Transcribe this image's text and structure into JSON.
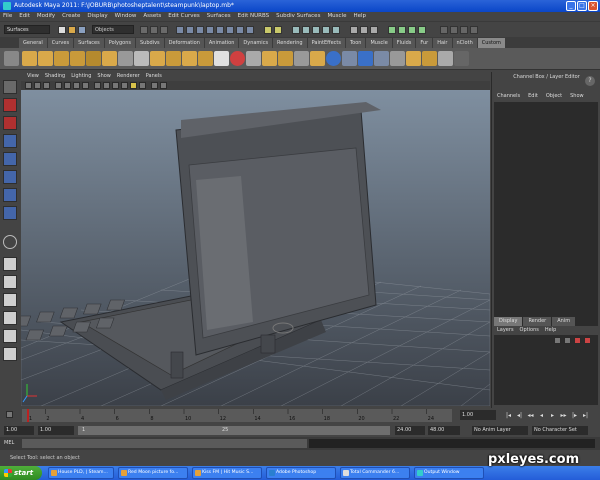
{
  "window": {
    "title": "Autodesk Maya 2011: F:\\JOBURB\\photosheptalent\\steampunk\\laptop.mb*"
  },
  "menubar": {
    "items": [
      "File",
      "Edit",
      "Modify",
      "Create",
      "Display",
      "Window",
      "Assets",
      "Edit Curves",
      "Surfaces",
      "Edit NURBS",
      "Subdiv Surfaces",
      "Muscle",
      "Help"
    ]
  },
  "statusline": {
    "mode": "Surfaces",
    "object_field": "Objects"
  },
  "shelf": {
    "tabs": [
      "General",
      "Curves",
      "Surfaces",
      "Polygons",
      "Subdivs",
      "Deformation",
      "Animation",
      "Dynamics",
      "Rendering",
      "PaintEffects",
      "Toon",
      "Muscle",
      "Fluids",
      "Fur",
      "Hair",
      "nCloth",
      "Custom"
    ],
    "active_tab": "Custom"
  },
  "viewport": {
    "menu": [
      "View",
      "Shading",
      "Lighting",
      "Show",
      "Renderer",
      "Panels"
    ]
  },
  "channel_box": {
    "title": "Channel Box / Layer Editor",
    "menu": [
      "Channels",
      "Edit",
      "Object",
      "Show"
    ],
    "layer_tabs": [
      "Display",
      "Render",
      "Anim"
    ],
    "active_layer_tab": "Display",
    "layer_menu": [
      "Layers",
      "Options",
      "Help"
    ]
  },
  "timeslider": {
    "ticks": [
      "1",
      "2",
      "4",
      "6",
      "8",
      "10",
      "12",
      "14",
      "16",
      "18",
      "20",
      "22",
      "24"
    ],
    "current_frame": "1.00"
  },
  "rangeslider": {
    "start": "1.00",
    "playback_start": "1.00",
    "range_low": "1",
    "range_high": "25",
    "playback_end": "24.00",
    "end": "48.00",
    "anim_layer": "No Anim Layer",
    "character_set": "No Character Set"
  },
  "command_line": {
    "label": "MEL"
  },
  "help_line": {
    "text": "Select Tool: select an object"
  },
  "taskbar": {
    "start": "start",
    "items": [
      "House PLD, | Steam...",
      "Red Moon picture fo...",
      "Kiss FM | Hit Music S...",
      "Adobe Photoshop",
      "Total Commander 6...",
      "Output Window"
    ]
  },
  "watermark": {
    "text": "pxleyes.com"
  }
}
